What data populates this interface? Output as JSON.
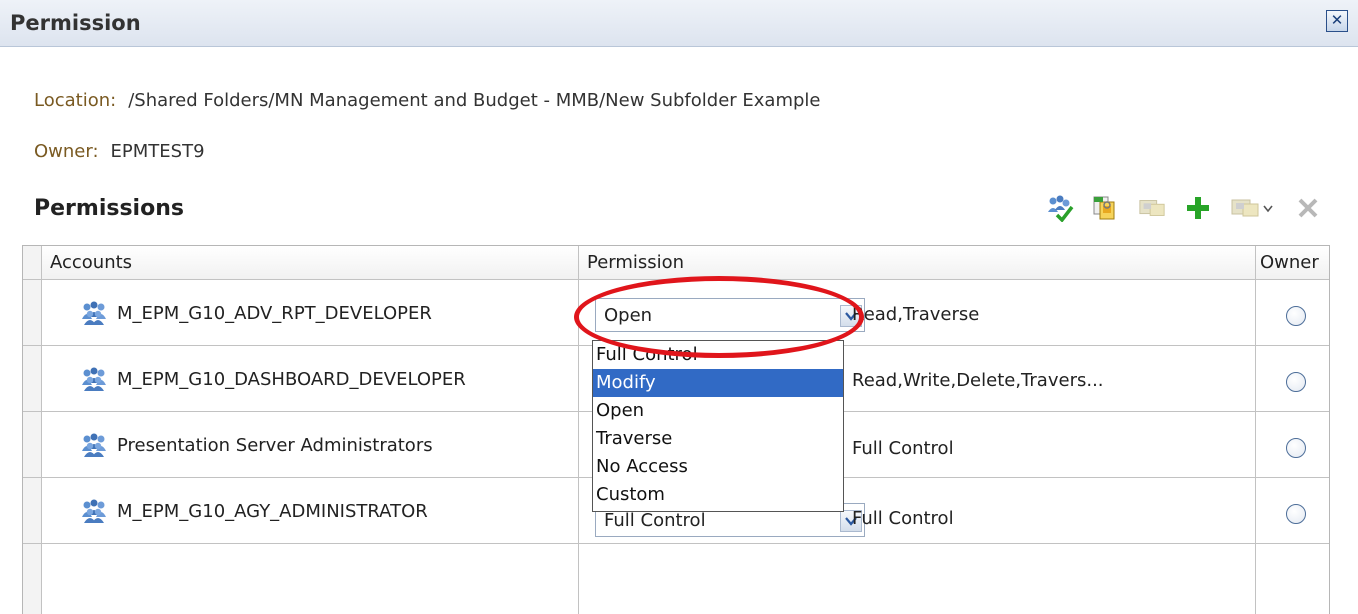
{
  "window": {
    "title": "Permission"
  },
  "location": {
    "label": "Location:",
    "value": "/Shared Folders/MN Management and Budget - MMB/New Subfolder Example"
  },
  "owner": {
    "label": "Owner:",
    "value": "EPMTEST9"
  },
  "permissions_section": {
    "title": "Permissions"
  },
  "toolbar": {
    "icons": [
      "set-permissions-icon",
      "copy-permissions-icon",
      "paste-permissions-icon",
      "add-icon",
      "paste-permissions-dropdown-icon",
      "delete-icon"
    ]
  },
  "table": {
    "columns": [
      "Accounts",
      "Permission",
      "Owner"
    ],
    "rows": [
      {
        "account": "M_EPM_G10_ADV_RPT_DEVELOPER",
        "select_value": "Open",
        "permission_text": "Read,Traverse"
      },
      {
        "account": "M_EPM_G10_DASHBOARD_DEVELOPER",
        "select_value": "",
        "permission_text": "Read,Write,Delete,Travers..."
      },
      {
        "account": "Presentation Server Administrators",
        "select_value": "",
        "permission_text": "Full Control"
      },
      {
        "account": "M_EPM_G10_AGY_ADMINISTRATOR",
        "select_value": "Full Control",
        "permission_text": "Full Control"
      }
    ]
  },
  "dropdown": {
    "options": [
      "Full Control",
      "Modify",
      "Open",
      "Traverse",
      "No Access",
      "Custom"
    ],
    "highlighted": "Modify"
  },
  "colors": {
    "callout": "#e0151b",
    "selection": "#316ac5",
    "label": "#7a5a22"
  }
}
